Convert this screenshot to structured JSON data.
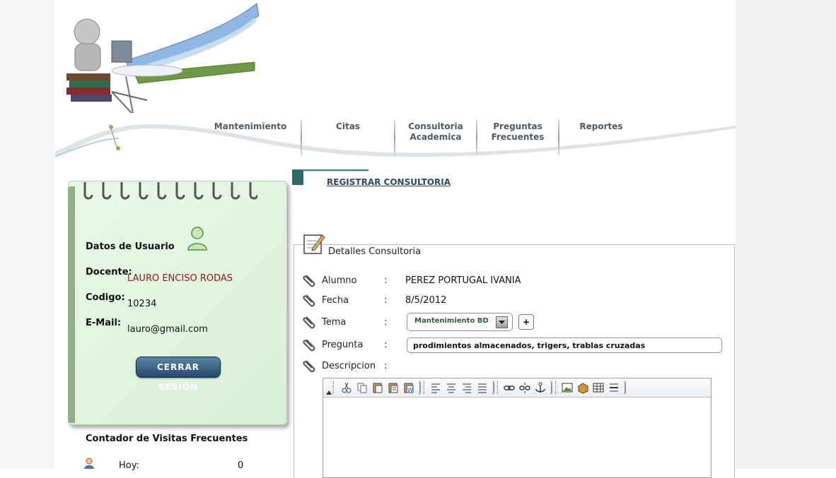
{
  "nav": {
    "items": [
      {
        "line1": "Mantenimiento",
        "line2": ""
      },
      {
        "line1": "Citas",
        "line2": ""
      },
      {
        "line1": "Consultoria",
        "line2": "Academica"
      },
      {
        "line1": "Preguntas",
        "line2": "Frecuentes"
      },
      {
        "line1": "Reportes",
        "line2": ""
      }
    ]
  },
  "user": {
    "title": "Datos de Usuario",
    "docente_label": "Docente:",
    "docente_value": "LAURO ENCISO RODAS",
    "codigo_label": "Codigo:",
    "codigo_value": "10234",
    "email_label": "E-Mail:",
    "email_value": "lauro@gmail.com",
    "logout_label": "CERRAR SESIÓN"
  },
  "visits": {
    "title": "Contador de Visitas Frecuentes",
    "today_label": "Hoy:",
    "today_value": "0"
  },
  "main": {
    "register_link": "REGISTRAR CONSULTORIA",
    "legend": "Detalles Consultoria",
    "separator": ":",
    "alumno_label": "Alumno",
    "alumno_value": "PEREZ PORTUGAL IVANIA",
    "fecha_label": "Fecha",
    "fecha_value": "8/5/2012",
    "tema_label": "Tema",
    "tema_value": "Mantenimiento BD",
    "plus_label": "+",
    "pregunta_label": "Pregunta",
    "pregunta_value": "prodimientos almacenados, trigers, trablas cruzadas",
    "descripcion_label": "Descripcion"
  },
  "colors": {
    "accent": "#2c4a66",
    "note_green": "#d7f0d4",
    "button_blue": "#22496d"
  }
}
